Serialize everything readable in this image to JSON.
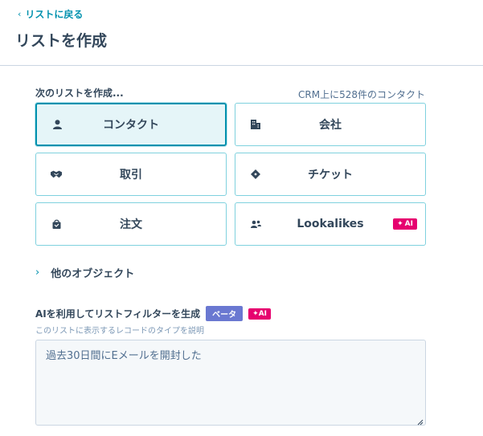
{
  "header": {
    "back_label": "リストに戻る",
    "title": "リストを作成"
  },
  "create": {
    "label": "次のリストを作成...",
    "count_text": "CRM上に528件のコンタクト",
    "tiles": [
      {
        "label": "コンタクト",
        "icon": "person-icon",
        "selected": true
      },
      {
        "label": "会社",
        "icon": "building-icon",
        "selected": false
      },
      {
        "label": "取引",
        "icon": "handshake-icon",
        "selected": false
      },
      {
        "label": "チケット",
        "icon": "ticket-icon",
        "selected": false
      },
      {
        "label": "注文",
        "icon": "shopping-bag-icon",
        "selected": false
      },
      {
        "label": "Lookalikes",
        "icon": "people-icon",
        "selected": false,
        "badge": "AI"
      }
    ]
  },
  "other_objects": {
    "label": "他のオブジェクト"
  },
  "ai_filter": {
    "title": "AIを利用してリストフィルターを生成",
    "beta_badge": "ベータ",
    "ai_badge": "AI",
    "description": "このリストに表示するレコードのタイプを説明",
    "input_value": "過去30日間にEメールを開封した"
  },
  "colors": {
    "accent": "#0091ae",
    "tile_border": "#7fd1de",
    "selected_bg": "#e5f5f8",
    "ai_pink": "#e6006f",
    "beta_purple": "#6a78d1",
    "text": "#33475b"
  }
}
